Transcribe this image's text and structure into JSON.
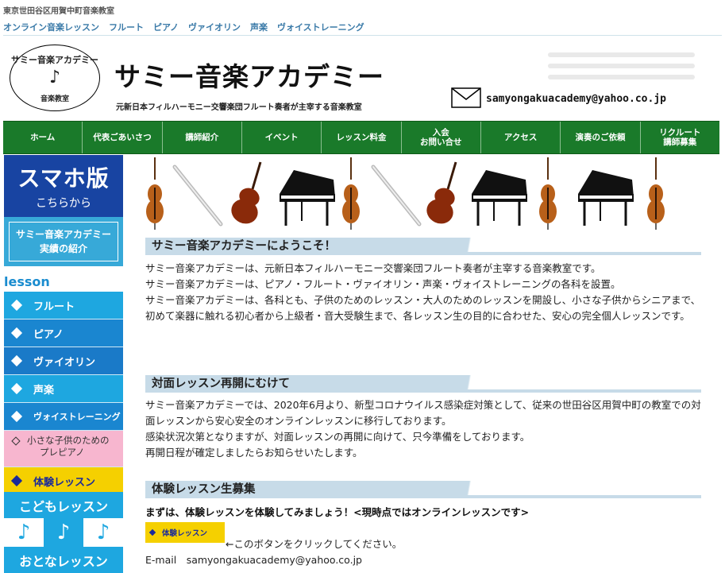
{
  "header": {
    "caption": "東京世田谷区用賀中町音楽教室",
    "topnav": [
      "オンライン音楽レッスン",
      "フルート",
      "ピアノ",
      "ヴァイオリン",
      "声楽",
      "ヴォイストレーニング"
    ],
    "logo": {
      "top": "サミー音楽アカデミー",
      "note": "♪",
      "bottom": "音楽教室"
    },
    "title": "サミー音楽アカデミー",
    "subtitle": "元新日本フィルハーモニー交響楽団フルート奏者が主宰する音楽教室",
    "email": "samyongakuacademy@yahoo.co.jp"
  },
  "mainnav": [
    "ホーム",
    "代表ごあいさつ",
    "講師紹介",
    "イベント",
    "レッスン料金",
    "入会\nお問い合せ",
    "アクセス",
    "演奏のご依頼",
    "リクルート\n講師募集"
  ],
  "sidebar": {
    "sumaho_big": "スマホ版",
    "sumaho_small": "こちらから",
    "jisseki_line1": "サミー音楽アカデミー",
    "jisseki_line2": "実績の紹介",
    "lesson_label": "lesson",
    "items": [
      {
        "label": "フルート",
        "color": "#1ea7e0"
      },
      {
        "label": "ピアノ",
        "color": "#1a86d0"
      },
      {
        "label": "ヴァイオリン",
        "color": "#1a7ac8"
      },
      {
        "label": "声楽",
        "color": "#1ea7e0"
      },
      {
        "label": "ヴォイストレーニング",
        "color": "#1a86d0"
      }
    ],
    "pink_line1": "小さな子供のための",
    "pink_line2": "プレピアノ",
    "trial": "体験レッスン",
    "kodomo": "こどもレッスン",
    "notes": [
      "♪",
      "♪",
      "♪"
    ],
    "otona": "おとなレッスン"
  },
  "main": {
    "sec1_title": "サミー音楽アカデミーにようこそ！",
    "sec1_lines": [
      "サミー音楽アカデミーは、元新日本フィルハーモニー交響楽団フルート奏者が主宰する音楽教室です。",
      "サミー音楽アカデミーは、ピアノ・フルート・ヴァイオリン・声楽・ヴォイストレーニングの各科を設置。",
      "サミー音楽アカデミーは、各科とも、子供のためのレッスン・大人のためのレッスンを開設し、小さな子供からシニアまで、",
      "初めて楽器に触れる初心者から上級者・音大受験生まで、各レッスン生の目的に合わせた、安心の完全個人レッスンです。"
    ],
    "sec2_title": "対面レッスン再開にむけて",
    "sec2_lines": [
      "サミー音楽アカデミーでは、2020年6月より、新型コロナウイルス感染症対策として、従来の世田谷区用賀中町の教室での対面レッスンから安心安全のオンラインレッスンに移行しております。",
      "感染状況次第となりますが、対面レッスンの再開に向けて、只今準備をしております。",
      "再開日程が確定しましたらお知らせいたします。"
    ],
    "sec3_title": "体験レッスン生募集",
    "sec3_bold": "まずは、体験レッスンを体験してみましょう！<現時点ではオンラインレッスンです>",
    "trial_button": "体験レッスン",
    "arrow_text": "←このボタンをクリックしてください。",
    "email_line": "E-mail　samyongakuacademy@yahoo.co.jp"
  }
}
